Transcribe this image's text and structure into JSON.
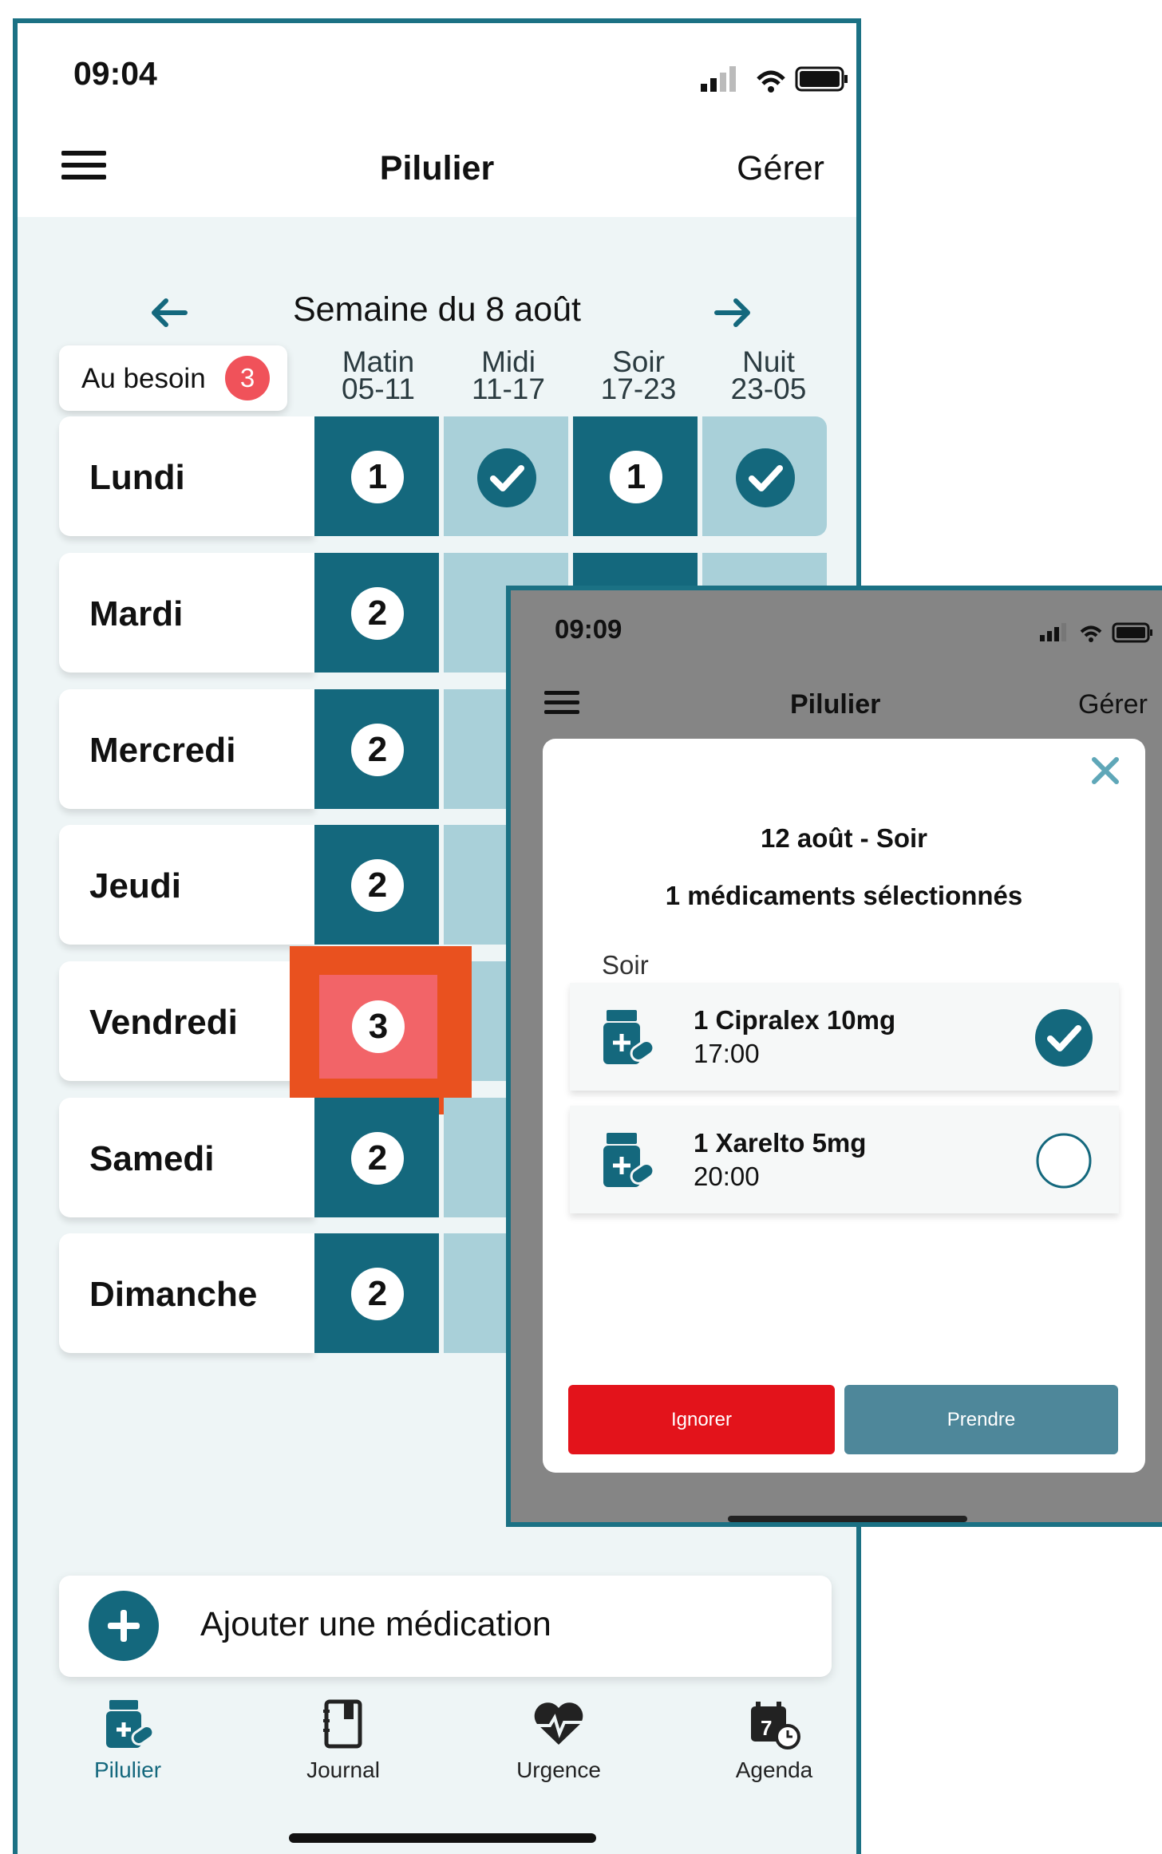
{
  "status_bar": {
    "time": "09:04"
  },
  "header": {
    "title": "Pilulier",
    "manage": "Gérer",
    "menu_icon": "hamburger-icon"
  },
  "week": {
    "title": "Semaine du 8 août",
    "prev_icon": "arrow-left-icon",
    "next_icon": "arrow-right-icon"
  },
  "as_needed": {
    "label": "Au besoin",
    "badge": "3"
  },
  "periods": [
    {
      "name": "Matin",
      "hours": "05-11"
    },
    {
      "name": "Midi",
      "hours": "11-17"
    },
    {
      "name": "Soir",
      "hours": "17-23"
    },
    {
      "name": "Nuit",
      "hours": "23-05"
    }
  ],
  "days": [
    {
      "name": "Lundi",
      "matin": "1",
      "soir": "1"
    },
    {
      "name": "Mardi",
      "matin": "2"
    },
    {
      "name": "Mercredi",
      "matin": "2"
    },
    {
      "name": "Jeudi",
      "matin": "2"
    },
    {
      "name": "Vendredi",
      "matin": "3"
    },
    {
      "name": "Samedi",
      "matin": "2"
    },
    {
      "name": "Dimanche",
      "matin": "2"
    }
  ],
  "add_button": {
    "label": "Ajouter une médication"
  },
  "tabs": [
    {
      "label": "Pilulier",
      "icon": "pill-bottle-icon"
    },
    {
      "label": "Journal",
      "icon": "journal-icon"
    },
    {
      "label": "Urgence",
      "icon": "heartbeat-icon"
    },
    {
      "label": "Agenda",
      "icon": "calendar-clock-icon"
    }
  ],
  "colors": {
    "primary": "#14687d",
    "light_cell": "#a9d0d9",
    "highlight": "#e9511f",
    "badge": "#f0525a",
    "ignore": "#e3131b",
    "take": "#4e879a"
  },
  "overlay": {
    "status_time": "09:09",
    "header_title": "Pilulier",
    "header_manage": "Gérer",
    "modal": {
      "title": "12 août - Soir",
      "subtitle": "1 médicaments sélectionnés",
      "section": "Soir",
      "medications": [
        {
          "name": "1 Cipralex 10mg",
          "time": "17:00",
          "selected": true
        },
        {
          "name": "1 Xarelto 5mg",
          "time": "20:00",
          "selected": false
        }
      ],
      "ignore_label": "Ignorer",
      "take_label": "Prendre"
    }
  }
}
